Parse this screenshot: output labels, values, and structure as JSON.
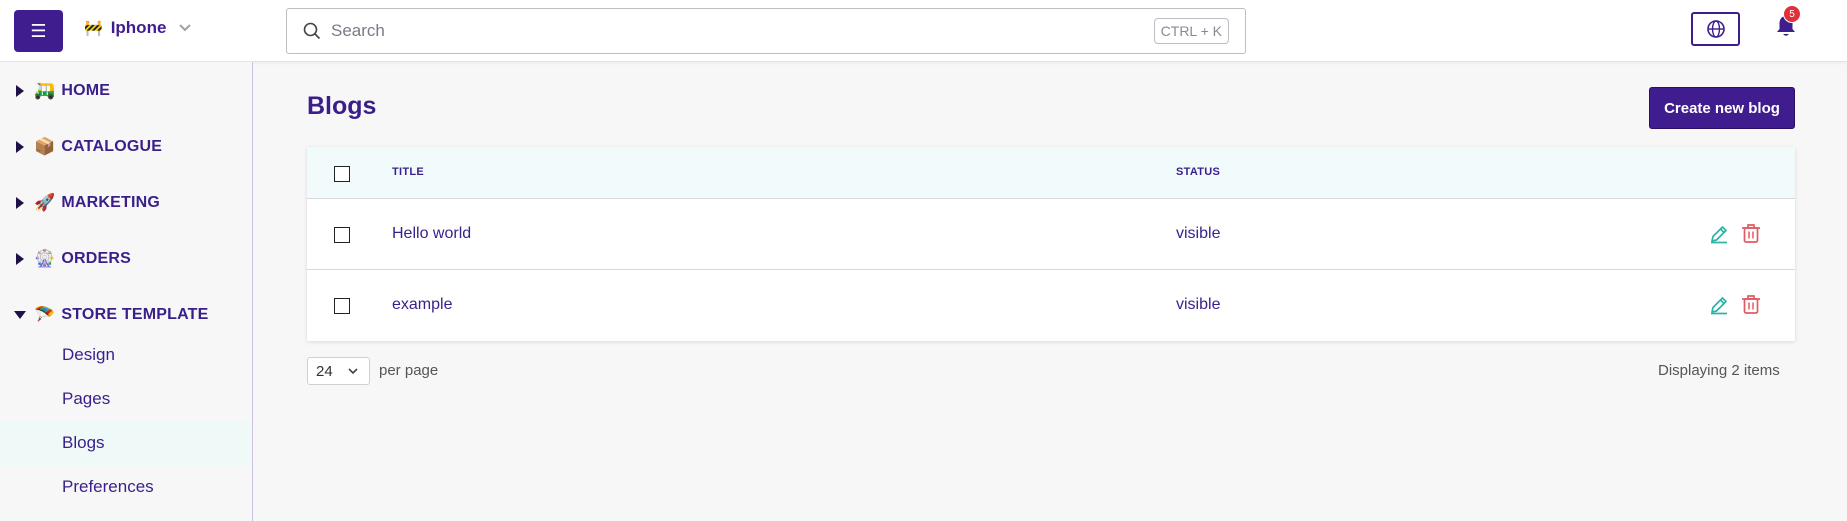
{
  "header": {
    "menu_icon": "hamburger-icon",
    "store_name": "Iphone",
    "store_emoji": "🚧",
    "search_placeholder": "Search",
    "search_shortcut": "CTRL + K",
    "notification_count": "5"
  },
  "sidebar": {
    "sections": [
      {
        "label": "HOME",
        "emoji": "🛺",
        "expanded": false
      },
      {
        "label": "CATALOGUE",
        "emoji": "📦",
        "expanded": false
      },
      {
        "label": "MARKETING",
        "emoji": "🚀",
        "expanded": false
      },
      {
        "label": "ORDERS",
        "emoji": "🎡",
        "expanded": false
      },
      {
        "label": "STORE TEMPLATE",
        "emoji": "🪂",
        "expanded": true
      }
    ],
    "sub_items": [
      {
        "label": "Design",
        "active": false
      },
      {
        "label": "Pages",
        "active": false
      },
      {
        "label": "Blogs",
        "active": true
      },
      {
        "label": "Preferences",
        "active": false
      }
    ]
  },
  "main": {
    "title": "Blogs",
    "create_button": "Create new blog",
    "table": {
      "columns": [
        "TITLE",
        "STATUS"
      ],
      "rows": [
        {
          "title": "Hello world",
          "status": "visible"
        },
        {
          "title": "example",
          "status": "visible"
        }
      ]
    },
    "pagination": {
      "per_page_value": "24",
      "per_page_label": "per page",
      "displaying": "Displaying 2 items"
    }
  },
  "colors": {
    "brand": "#3f1d8f",
    "edit_icon": "#2bb3a6",
    "delete_icon": "#e25a62",
    "badge": "#e0313a"
  }
}
